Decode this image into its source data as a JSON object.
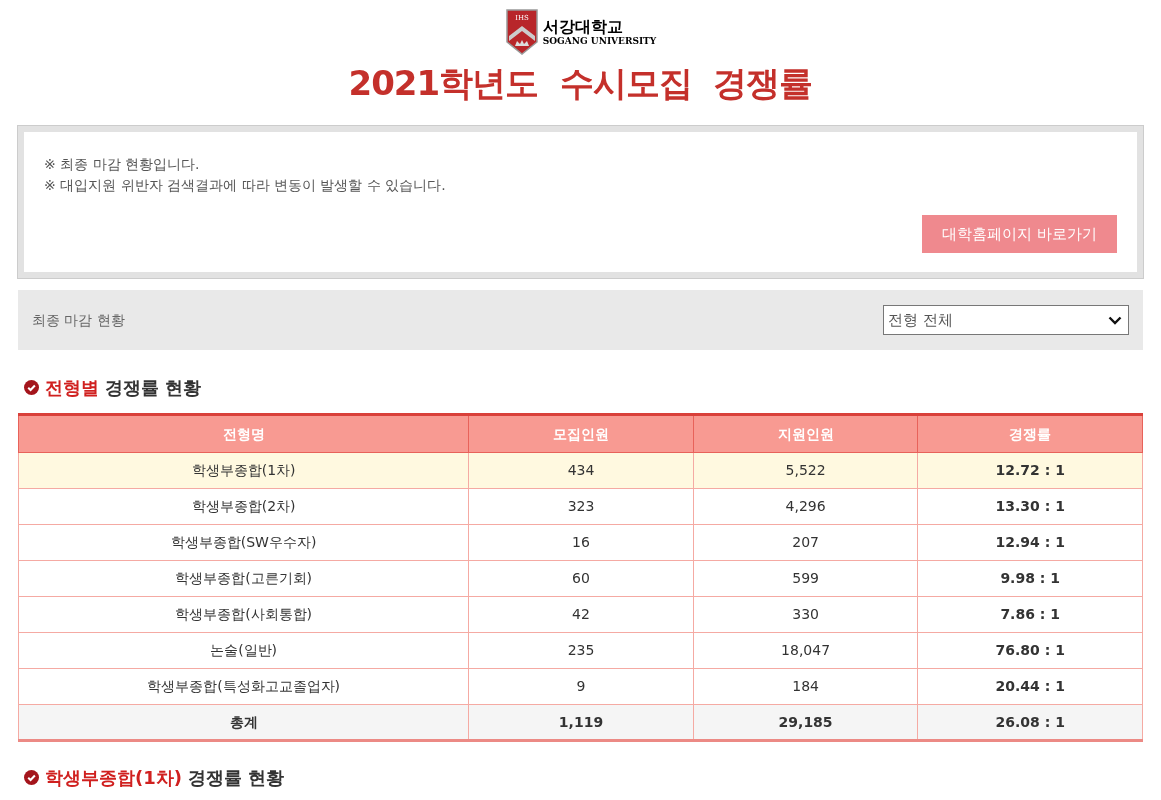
{
  "logo": {
    "shield_text": "IHS",
    "name_ko": "서강대학교",
    "name_en": "SOGANG UNIVERSITY"
  },
  "title": "2021학년도  수시모집  경쟁률",
  "notice": {
    "lines": [
      "※ 최종 마감 현황입니다.",
      "※ 대입지원 위반자 검색결과에 따라 변동이 발생할 수 있습니다."
    ],
    "button": "대학홈페이지 바로가기"
  },
  "filter_bar": {
    "label": "최종 마감 현황",
    "select": "전형 전체"
  },
  "sections": [
    {
      "highlight": "전형별",
      "text": "경쟁률 현황"
    },
    {
      "highlight": "학생부종합(1차)",
      "text": "경쟁률 현황"
    }
  ],
  "table": {
    "columns": [
      "전형명",
      "모집인원",
      "지원인원",
      "경쟁률"
    ],
    "rows": [
      {
        "kind": "data",
        "highlighted": true,
        "cells": [
          "학생부종합(1차)",
          "434",
          "5,522",
          "12.72 : 1"
        ]
      },
      {
        "kind": "data",
        "highlighted": false,
        "cells": [
          "학생부종합(2차)",
          "323",
          "4,296",
          "13.30 : 1"
        ]
      },
      {
        "kind": "data",
        "highlighted": false,
        "cells": [
          "학생부종합(SW우수자)",
          "16",
          "207",
          "12.94 : 1"
        ]
      },
      {
        "kind": "data",
        "highlighted": false,
        "cells": [
          "학생부종합(고른기회)",
          "60",
          "599",
          "9.98 : 1"
        ]
      },
      {
        "kind": "data",
        "highlighted": false,
        "cells": [
          "학생부종합(사회통합)",
          "42",
          "330",
          "7.86 : 1"
        ]
      },
      {
        "kind": "data",
        "highlighted": false,
        "cells": [
          "논술(일반)",
          "235",
          "18,047",
          "76.80 : 1"
        ]
      },
      {
        "kind": "data",
        "highlighted": false,
        "cells": [
          "학생부종합(특성화고교졸업자)",
          "9",
          "184",
          "20.44 : 1"
        ]
      },
      {
        "kind": "total",
        "highlighted": false,
        "cells": [
          "총계",
          "1,119",
          "29,185",
          "26.08 : 1"
        ]
      }
    ]
  }
}
